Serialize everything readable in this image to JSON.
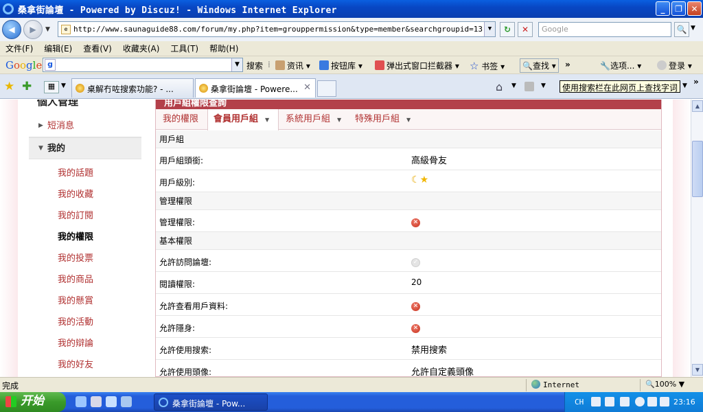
{
  "window": {
    "title": "桑拿街論壇 - Powered by Discuz! - Windows Internet Explorer"
  },
  "address_bar": {
    "url": "http://www.saunaguide88.com/forum/my.php?item=grouppermission&type=member&searchgroupid=13",
    "search_placeholder": "Google"
  },
  "menu": [
    "文件(F)",
    "编辑(E)",
    "查看(V)",
    "收藏夹(A)",
    "工具(T)",
    "帮助(H)"
  ],
  "google_toolbar": {
    "logo": [
      "G",
      "o",
      "o",
      "g",
      "l",
      "e"
    ],
    "box_label": "g",
    "search": "搜索",
    "items": [
      "资讯",
      "按钮库",
      "弹出式窗口拦截器",
      "书签",
      "查找",
      "选项...",
      "登录"
    ]
  },
  "tabs": [
    {
      "label": "桌解冇咗搜索功能? - ..."
    },
    {
      "label": "桑拿街論壇 - Powere..."
    }
  ],
  "tooltip": "使用搜索栏在此网页上查找字词",
  "sidebar": {
    "heading": "個人管理",
    "cat_messages": "短消息",
    "cat_mine": "我的",
    "items": [
      "我的話題",
      "我的收藏",
      "我的訂閱",
      "我的權限",
      "我的投票",
      "我的商品",
      "我的懸賞",
      "我的活動",
      "我的辯論",
      "我的好友"
    ]
  },
  "main": {
    "header": "用戶組權限查詢",
    "subtabs": [
      "我的權限",
      "會員用戶組",
      "系統用戶組",
      "特殊用戶組"
    ],
    "rows": [
      {
        "label": "用戶組",
        "section": true
      },
      {
        "label": "用戶組頭銜:",
        "value": "高級骨友"
      },
      {
        "label": "用戶級別:",
        "value_icon": "moon-star-rank"
      },
      {
        "label": "管理權限",
        "section": true
      },
      {
        "label": "管理權限:",
        "value_icon": "denied"
      },
      {
        "label": "基本權限",
        "section": true
      },
      {
        "label": "允許訪問論壇:",
        "value_icon": "allowed"
      },
      {
        "label": "閱讀權限:",
        "value": "20"
      },
      {
        "label": "允許查看用戶資料:",
        "value_icon": "denied"
      },
      {
        "label": "允許隱身:",
        "value_icon": "denied"
      },
      {
        "label": "允許使用搜索:",
        "value": "禁用搜索"
      },
      {
        "label": "允許使用頭像:",
        "value": "允許自定義頭像"
      }
    ]
  },
  "statusbar": {
    "status": "完成",
    "zone": "Internet",
    "zoom": "100%"
  },
  "taskbar": {
    "start": "开始",
    "task": "桑拿街論壇 - Pow...",
    "ime": "CH",
    "clock": "23:16"
  },
  "colors": {
    "accent": "#b3404a",
    "link": "#b03030"
  }
}
